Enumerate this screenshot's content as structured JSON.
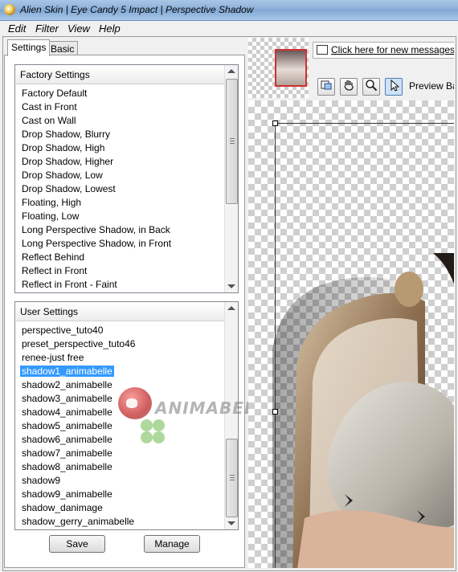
{
  "window": {
    "title": "Alien Skin | Eye Candy 5 Impact | Perspective Shadow"
  },
  "menu": [
    "Edit",
    "Filter",
    "View",
    "Help"
  ],
  "tabs": [
    "Settings",
    "Basic"
  ],
  "factory": {
    "header": "Factory Settings",
    "items": [
      "Factory Default",
      "Cast in Front",
      "Cast on Wall",
      "Drop Shadow, Blurry",
      "Drop Shadow, High",
      "Drop Shadow, Higher",
      "Drop Shadow, Low",
      "Drop Shadow, Lowest",
      "Floating, High",
      "Floating, Low",
      "Long Perspective Shadow, in Back",
      "Long Perspective Shadow, in Front",
      "Reflect Behind",
      "Reflect in Front",
      "Reflect in Front - Faint"
    ]
  },
  "user": {
    "header": "User Settings",
    "items": [
      "perspective_tuto40",
      "preset_perspective_tuto46",
      "renee-just free",
      "shadow1_animabelle",
      "shadow2_animabelle",
      "shadow3_animabelle",
      "shadow4_animabelle",
      "shadow5_animabelle",
      "shadow6_animabelle",
      "shadow7_animabelle",
      "shadow8_animabelle",
      "shadow9",
      "shadow9_animabelle",
      "shadow_danimage",
      "shadow_gerry_animabelle"
    ],
    "selected_index": 3
  },
  "buttons": {
    "save": "Save",
    "manage": "Manage"
  },
  "messages": {
    "link": "Click here for new messages from"
  },
  "preview": {
    "label": "Preview Backgrou"
  },
  "watermark": {
    "text": "ANIMABELLE"
  },
  "tools": [
    "navigator-icon",
    "hand-icon",
    "zoom-icon",
    "arrow-icon"
  ],
  "colors": {
    "selection": "#3399ff",
    "titlebar": "#8db1d9",
    "thumb_frame": "#d03030"
  }
}
